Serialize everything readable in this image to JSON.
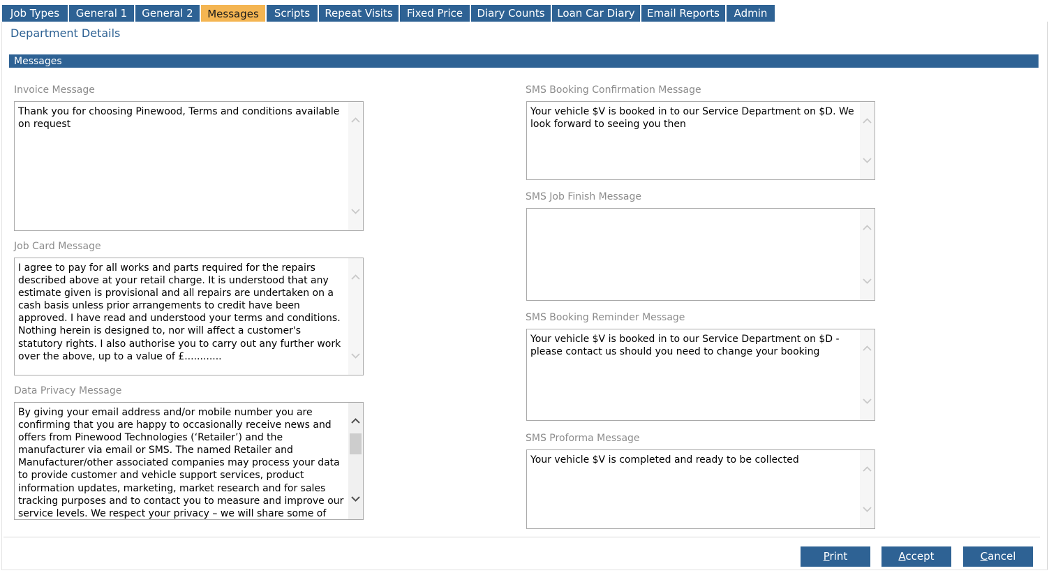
{
  "tabs": [
    {
      "label": "Job Types",
      "active": false
    },
    {
      "label": "General 1",
      "active": false
    },
    {
      "label": "General 2",
      "active": false
    },
    {
      "label": "Messages",
      "active": true
    },
    {
      "label": "Scripts",
      "active": false
    },
    {
      "label": "Repeat Visits",
      "active": false
    },
    {
      "label": "Fixed Price",
      "active": false
    },
    {
      "label": "Diary Counts",
      "active": false
    },
    {
      "label": "Loan Car Diary",
      "active": false
    },
    {
      "label": "Email Reports",
      "active": false
    },
    {
      "label": "Admin",
      "active": false
    }
  ],
  "page_title": "Department Details",
  "section_title": "Messages",
  "fields": {
    "invoice": {
      "label": "Invoice Message",
      "value": "Thank you for choosing Pinewood, Terms and conditions available on request"
    },
    "job_card": {
      "label": "Job Card Message",
      "value": "I agree to pay for all works and parts required for the repairs described above at your retail charge. It is understood that any estimate given is provisional and all repairs are undertaken on a cash basis unless prior arrangements to credit have been approved. I have read and understood your terms and conditions. Nothing herein is designed to, nor will affect a customer's statutory rights. I also authorise you to carry out any further work over the above, up to a value of £............"
    },
    "data_privacy": {
      "label": "Data Privacy Message",
      "value": "By giving your email address and/or mobile number you are confirming that you are happy to occasionally receive news and offers from Pinewood Technologies (‘Retailer’) and the manufacturer via email or SMS. The named Retailer and Manufacturer/other associated companies may process your data to provide customer and vehicle support services, product information updates, marketing, market research and for sales tracking purposes and to contact you to measure and improve our service levels. We respect your privacy – we will share some of your information within the Manufacturers"
    },
    "sms_booking_confirmation": {
      "label": "SMS Booking Confirmation Message",
      "value": "Your vehicle $V is booked in to our Service Department on $D. We look forward to seeing you then"
    },
    "sms_job_finish": {
      "label": "SMS Job Finish Message",
      "value": ""
    },
    "sms_booking_reminder": {
      "label": "SMS Booking Reminder Message",
      "value": "Your vehicle $V is booked in to our Service Department on $D - please contact us should you need to change your booking"
    },
    "sms_proforma": {
      "label": "SMS Proforma Message",
      "value": "Your vehicle $V is completed and ready to be collected"
    }
  },
  "buttons": {
    "print": {
      "accel": "P",
      "rest": "rint"
    },
    "accept": {
      "accel": "A",
      "rest": "ccept"
    },
    "cancel": {
      "accel": "C",
      "rest": "ancel"
    }
  },
  "colors": {
    "tab_bg": "#2e6294",
    "tab_active_bg": "#f4b552",
    "section_bar_bg": "#2e6294",
    "title_text": "#2e6294",
    "label_text": "#8c8c8c"
  },
  "icons": {
    "scroll_up": "chevron-up-icon",
    "scroll_down": "chevron-down-icon"
  }
}
